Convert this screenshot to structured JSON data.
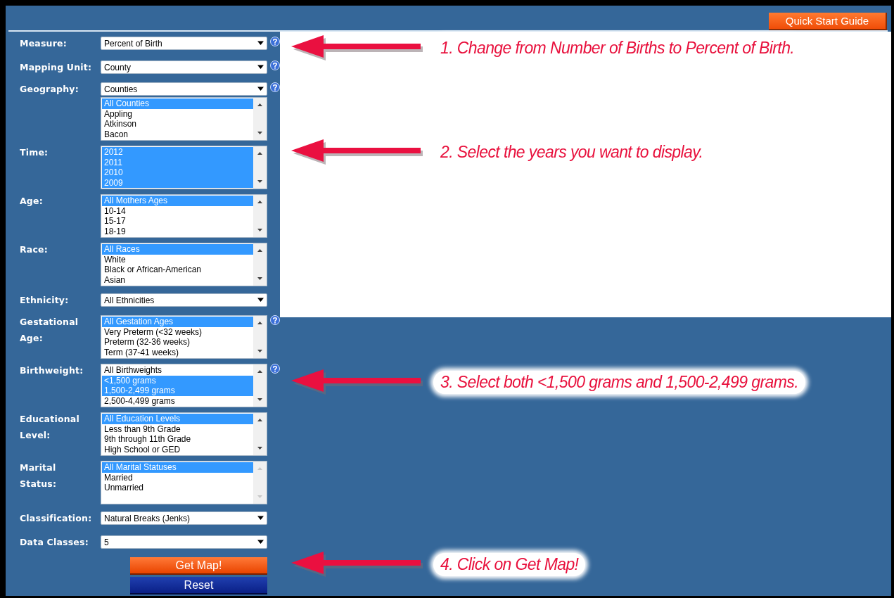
{
  "header": {
    "guide_button": "Quick Start Guide"
  },
  "fields": [
    {
      "label": "Measure:",
      "help": true,
      "select": {
        "value": "Percent of Birth"
      }
    },
    {
      "label": "Mapping Unit:",
      "help": true,
      "select": {
        "value": "County"
      }
    },
    {
      "label": "Geography:",
      "help": true,
      "select": {
        "value": "Counties"
      },
      "list": {
        "scrollbar_disabled": false,
        "options": [
          {
            "text": "All Counties",
            "selected": true
          },
          {
            "text": "Appling",
            "selected": false
          },
          {
            "text": "Atkinson",
            "selected": false
          },
          {
            "text": "Bacon",
            "selected": false
          }
        ]
      }
    },
    {
      "label": "Time:",
      "help": false,
      "list": {
        "scrollbar_disabled": false,
        "options": [
          {
            "text": "2012",
            "selected": true
          },
          {
            "text": "2011",
            "selected": true
          },
          {
            "text": "2010",
            "selected": true
          },
          {
            "text": "2009",
            "selected": true
          }
        ]
      }
    },
    {
      "label": "Age:",
      "help": false,
      "list": {
        "scrollbar_disabled": false,
        "options": [
          {
            "text": "All Mothers Ages",
            "selected": true
          },
          {
            "text": "10-14",
            "selected": false
          },
          {
            "text": "15-17",
            "selected": false
          },
          {
            "text": "18-19",
            "selected": false
          }
        ]
      }
    },
    {
      "label": "Race:",
      "help": false,
      "list": {
        "scrollbar_disabled": false,
        "options": [
          {
            "text": "All Races",
            "selected": true
          },
          {
            "text": "White",
            "selected": false
          },
          {
            "text": "Black or African-American",
            "selected": false
          },
          {
            "text": "Asian",
            "selected": false
          }
        ]
      }
    },
    {
      "label": "Ethnicity:",
      "help": false,
      "select": {
        "value": "All Ethnicities"
      }
    },
    {
      "label": "Gestational Age:",
      "help": true,
      "list": {
        "scrollbar_disabled": false,
        "options": [
          {
            "text": "All Gestation Ages",
            "selected": true
          },
          {
            "text": "Very Preterm (<32 weeks)",
            "selected": false
          },
          {
            "text": "Preterm (32-36 weeks)",
            "selected": false
          },
          {
            "text": "Term (37-41 weeks)",
            "selected": false
          }
        ]
      }
    },
    {
      "label": "Birthweight:",
      "help": true,
      "list": {
        "scrollbar_disabled": false,
        "options": [
          {
            "text": "All Birthweights",
            "selected": false
          },
          {
            "text": "<1,500 grams",
            "selected": true
          },
          {
            "text": "1,500-2,499 grams",
            "selected": true
          },
          {
            "text": "2,500-4,499 grams",
            "selected": false
          }
        ]
      }
    },
    {
      "label": "Educational Level:",
      "help": false,
      "list": {
        "scrollbar_disabled": false,
        "options": [
          {
            "text": "All Education Levels",
            "selected": true
          },
          {
            "text": "Less than 9th Grade",
            "selected": false
          },
          {
            "text": "9th through 11th Grade",
            "selected": false
          },
          {
            "text": "High School or GED",
            "selected": false
          }
        ]
      }
    },
    {
      "label": "Marital Status:",
      "help": false,
      "list": {
        "scrollbar_disabled": true,
        "options": [
          {
            "text": "All Marital Statuses",
            "selected": true
          },
          {
            "text": "Married",
            "selected": false
          },
          {
            "text": "Unmarried",
            "selected": false
          }
        ]
      }
    },
    {
      "label": "Classification:",
      "help": false,
      "select": {
        "value": "Natural Breaks (Jenks)"
      }
    },
    {
      "label": "Data Classes:",
      "help": false,
      "select": {
        "value": "5"
      }
    }
  ],
  "buttons": [
    {
      "label": "Get Map!",
      "kind": "primary"
    },
    {
      "label": "Reset",
      "kind": "secondary"
    }
  ],
  "notes": [
    {
      "text": "1. Change from Number of Births to Percent of Birth."
    },
    {
      "text": "2. Select the years you want to display."
    },
    {
      "text": "3. Select both <1,500 grams and 1,500-2,499 grams."
    },
    {
      "text": "4. Click on Get Map!"
    }
  ]
}
